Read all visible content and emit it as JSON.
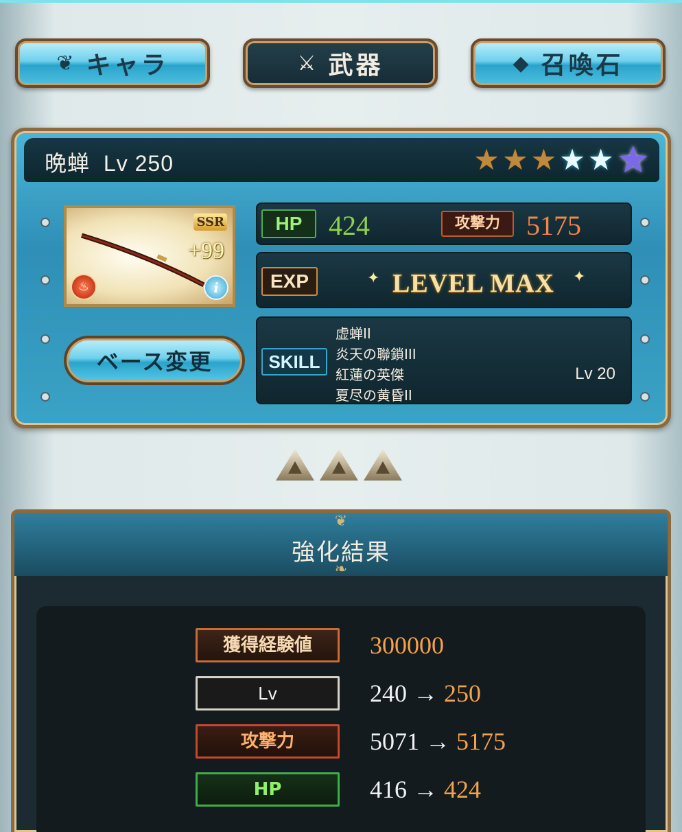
{
  "tabs": [
    {
      "label": "キャラ",
      "icon": "character-emblem-icon",
      "active": false
    },
    {
      "label": "武器",
      "icon": "crossed-weapons-icon",
      "active": true
    },
    {
      "label": "召喚石",
      "icon": "crystal-icon",
      "active": false
    }
  ],
  "weapon": {
    "name": "晩蝉",
    "level_text": "Lv 250",
    "rarity": "SSR",
    "plus": "+99",
    "element": "fire",
    "stars": [
      "gold",
      "gold",
      "gold",
      "blue",
      "blue",
      "purple"
    ]
  },
  "stats": {
    "hp_label": "HP",
    "hp_value": "424",
    "atk_label": "攻撃力",
    "atk_value": "5175",
    "exp_label": "EXP",
    "exp_status": "LEVEL MAX",
    "skill_label": "SKILL",
    "skills": [
      "虚蝉II",
      "炎天の聯鎖III",
      "紅蓮の英傑",
      "夏尽の黄昏II"
    ],
    "skill_level": "Lv 20"
  },
  "base_change_label": "ベース変更",
  "result": {
    "title": "強化結果",
    "exp_label": "獲得経験値",
    "exp_value": "300000",
    "lv_label": "Lv",
    "lv_from": "240",
    "lv_to": "250",
    "atk_label": "攻撃力",
    "atk_from": "5071",
    "atk_to": "5175",
    "hp_label": "HP",
    "hp_from": "416",
    "hp_to": "424",
    "arrow": "→"
  },
  "colors": {
    "accent_blue": "#2aa4cc",
    "frame_gold": "#8a6a3e",
    "hp_green": "#8ff06a",
    "atk_orange": "#f7a14a"
  }
}
